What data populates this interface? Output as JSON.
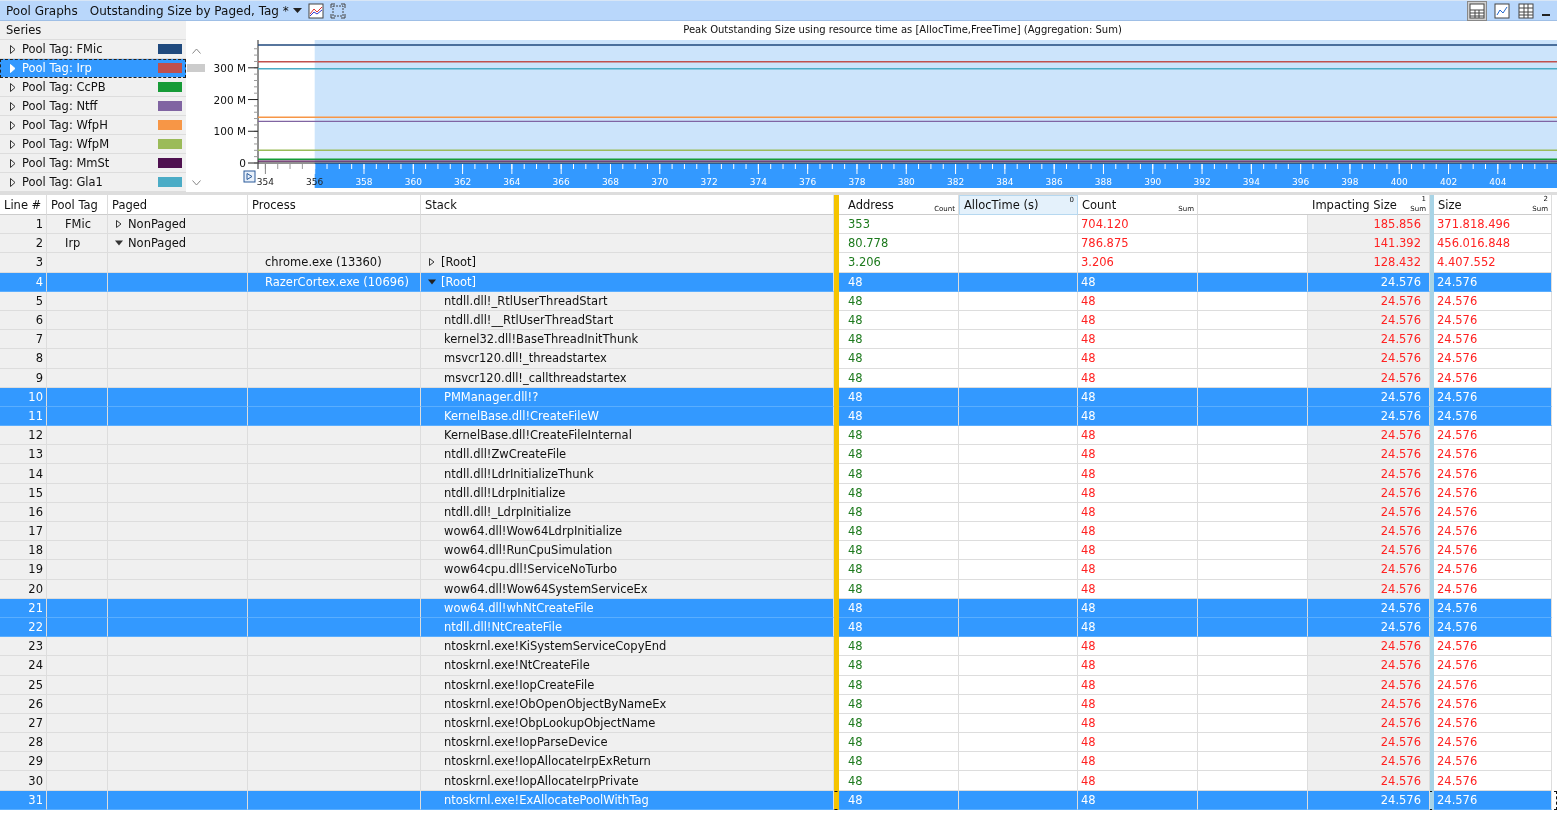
{
  "toolbar": {
    "title": "Pool Graphs",
    "view_name": "Outstanding Size by Paged, Tag *"
  },
  "series_panel": {
    "header": "Series",
    "items": [
      {
        "selected": false
      },
      {
        "selected": true
      },
      {
        "selected": false
      },
      {
        "selected": false
      },
      {
        "selected": false
      },
      {
        "selected": false
      },
      {
        "selected": false
      },
      {
        "selected": false
      }
    ]
  },
  "chart": {
    "chart_data": {
      "type": "line",
      "title": "Peak Outstanding Size using resource time as [AllocTime,FreeTime] (Aggregation: Sum)",
      "x": [
        353.7,
        406.4
      ],
      "xlim": [
        353.7,
        406.4
      ],
      "ylim": [
        0,
        375
      ],
      "xticks": [
        354,
        356,
        358,
        360,
        362,
        364,
        366,
        368,
        370,
        372,
        374,
        376,
        378,
        380,
        382,
        384,
        386,
        388,
        390,
        392,
        394,
        396,
        398,
        400,
        402,
        404
      ],
      "yticks": [
        {
          "value": 0,
          "label": "0"
        },
        {
          "value": 100,
          "label": "100 M"
        },
        {
          "value": 200,
          "label": "200 M"
        },
        {
          "value": 300,
          "label": "300 M"
        }
      ],
      "series": [
        {
          "name": "Pool Tag: FMic",
          "color": "#1f497d",
          "values": [
            372,
            372
          ]
        },
        {
          "name": "Pool Tag: Irp",
          "color": "#c0504d",
          "values": [
            319,
            319
          ]
        },
        {
          "name": "Pool Tag: CcPB",
          "color": "#169b37",
          "values": [
            12,
            12
          ]
        },
        {
          "name": "Pool Tag: Ntff",
          "color": "#8064a2",
          "values": [
            131,
            131
          ]
        },
        {
          "name": "Pool Tag: WfpH",
          "color": "#f79646",
          "values": [
            144,
            144
          ]
        },
        {
          "name": "Pool Tag: WfpM",
          "color": "#9bbb59",
          "values": [
            40,
            40
          ]
        },
        {
          "name": "Pool Tag: MmSt",
          "color": "#4f1150",
          "values": [
            6,
            6
          ]
        },
        {
          "name": "Pool Tag: Gla1",
          "color": "#4bacc6",
          "values": [
            297,
            297
          ]
        }
      ]
    }
  },
  "table": {
    "columns": [
      {
        "label": "Line #"
      },
      {
        "label": "Pool Tag"
      },
      {
        "label": "Paged"
      },
      {
        "label": "Process"
      },
      {
        "label": "Stack"
      },
      {
        "label": "Address",
        "agg": "Count"
      },
      {
        "label": "AllocTime (s)",
        "agg": "0"
      },
      {
        "label": "Count",
        "agg": "Sum"
      },
      {
        "label": "Impacting Size",
        "agg": "Sum",
        "index": "1"
      },
      {
        "label": "Size",
        "agg": "Sum",
        "index": "2"
      }
    ],
    "rows": [
      {
        "line": "1",
        "kind": "tag",
        "pool_tag": "FMic",
        "paged": "NonPaged",
        "expanded": false,
        "address": "353",
        "count": "704.120",
        "impacting_size": "185.856",
        "size": "371.818.496",
        "selected": false
      },
      {
        "line": "2",
        "kind": "tag",
        "pool_tag": "Irp",
        "paged": "NonPaged",
        "expanded": true,
        "address": "80.778",
        "count": "786.875",
        "impacting_size": "141.392",
        "size": "456.016.848",
        "selected": false
      },
      {
        "line": "3",
        "kind": "process",
        "process": "chrome.exe (13360)",
        "stack": "[Root]",
        "expanded": false,
        "address": "3.206",
        "count": "3.206",
        "impacting_size": "128.432",
        "size": "4.407.552",
        "selected": false
      },
      {
        "line": "4",
        "kind": "process",
        "process": "RazerCortex.exe (10696)",
        "stack": "[Root]",
        "expanded": true,
        "address": "48",
        "count": "48",
        "impacting_size": "24.576",
        "size": "24.576",
        "selected": true
      },
      {
        "line": "5",
        "kind": "frame",
        "stack": "ntdll.dll!_RtlUserThreadStart",
        "address": "48",
        "count": "48",
        "impacting_size": "24.576",
        "size": "24.576",
        "selected": false
      },
      {
        "line": "6",
        "kind": "frame",
        "stack": "ntdll.dll!__RtlUserThreadStart",
        "address": "48",
        "count": "48",
        "impacting_size": "24.576",
        "size": "24.576",
        "selected": false
      },
      {
        "line": "7",
        "kind": "frame",
        "stack": "kernel32.dll!BaseThreadInitThunk",
        "address": "48",
        "count": "48",
        "impacting_size": "24.576",
        "size": "24.576",
        "selected": false
      },
      {
        "line": "8",
        "kind": "frame",
        "stack": "msvcr120.dll!_threadstartex",
        "address": "48",
        "count": "48",
        "impacting_size": "24.576",
        "size": "24.576",
        "selected": false
      },
      {
        "line": "9",
        "kind": "frame",
        "stack": "msvcr120.dll!_callthreadstartex",
        "address": "48",
        "count": "48",
        "impacting_size": "24.576",
        "size": "24.576",
        "selected": false
      },
      {
        "line": "10",
        "kind": "frame",
        "stack": "PMManager.dll!?",
        "address": "48",
        "count": "48",
        "impacting_size": "24.576",
        "size": "24.576",
        "selected": true
      },
      {
        "line": "11",
        "kind": "frame",
        "stack": "KernelBase.dll!CreateFileW",
        "address": "48",
        "count": "48",
        "impacting_size": "24.576",
        "size": "24.576",
        "selected": true
      },
      {
        "line": "12",
        "kind": "frame",
        "stack": "KernelBase.dll!CreateFileInternal",
        "address": "48",
        "count": "48",
        "impacting_size": "24.576",
        "size": "24.576",
        "selected": false
      },
      {
        "line": "13",
        "kind": "frame",
        "stack": "ntdll.dll!ZwCreateFile",
        "address": "48",
        "count": "48",
        "impacting_size": "24.576",
        "size": "24.576",
        "selected": false
      },
      {
        "line": "14",
        "kind": "frame",
        "stack": "ntdll.dll!LdrInitializeThunk",
        "address": "48",
        "count": "48",
        "impacting_size": "24.576",
        "size": "24.576",
        "selected": false
      },
      {
        "line": "15",
        "kind": "frame",
        "stack": "ntdll.dll!LdrpInitialize",
        "address": "48",
        "count": "48",
        "impacting_size": "24.576",
        "size": "24.576",
        "selected": false
      },
      {
        "line": "16",
        "kind": "frame",
        "stack": "ntdll.dll!_LdrpInitialize",
        "address": "48",
        "count": "48",
        "impacting_size": "24.576",
        "size": "24.576",
        "selected": false
      },
      {
        "line": "17",
        "kind": "frame",
        "stack": "wow64.dll!Wow64LdrpInitialize",
        "address": "48",
        "count": "48",
        "impacting_size": "24.576",
        "size": "24.576",
        "selected": false
      },
      {
        "line": "18",
        "kind": "frame",
        "stack": "wow64.dll!RunCpuSimulation",
        "address": "48",
        "count": "48",
        "impacting_size": "24.576",
        "size": "24.576",
        "selected": false
      },
      {
        "line": "19",
        "kind": "frame",
        "stack": "wow64cpu.dll!ServiceNoTurbo",
        "address": "48",
        "count": "48",
        "impacting_size": "24.576",
        "size": "24.576",
        "selected": false
      },
      {
        "line": "20",
        "kind": "frame",
        "stack": "wow64.dll!Wow64SystemServiceEx",
        "address": "48",
        "count": "48",
        "impacting_size": "24.576",
        "size": "24.576",
        "selected": false
      },
      {
        "line": "21",
        "kind": "frame",
        "stack": "wow64.dll!whNtCreateFile",
        "address": "48",
        "count": "48",
        "impacting_size": "24.576",
        "size": "24.576",
        "selected": true
      },
      {
        "line": "22",
        "kind": "frame",
        "stack": "ntdll.dll!NtCreateFile",
        "address": "48",
        "count": "48",
        "impacting_size": "24.576",
        "size": "24.576",
        "selected": true
      },
      {
        "line": "23",
        "kind": "frame",
        "stack": "ntoskrnl.exe!KiSystemServiceCopyEnd",
        "address": "48",
        "count": "48",
        "impacting_size": "24.576",
        "size": "24.576",
        "selected": false
      },
      {
        "line": "24",
        "kind": "frame",
        "stack": "ntoskrnl.exe!NtCreateFile",
        "address": "48",
        "count": "48",
        "impacting_size": "24.576",
        "size": "24.576",
        "selected": false
      },
      {
        "line": "25",
        "kind": "frame",
        "stack": "ntoskrnl.exe!IopCreateFile",
        "address": "48",
        "count": "48",
        "impacting_size": "24.576",
        "size": "24.576",
        "selected": false
      },
      {
        "line": "26",
        "kind": "frame",
        "stack": "ntoskrnl.exe!ObOpenObjectByNameEx",
        "address": "48",
        "count": "48",
        "impacting_size": "24.576",
        "size": "24.576",
        "selected": false
      },
      {
        "line": "27",
        "kind": "frame",
        "stack": "ntoskrnl.exe!ObpLookupObjectName",
        "address": "48",
        "count": "48",
        "impacting_size": "24.576",
        "size": "24.576",
        "selected": false
      },
      {
        "line": "28",
        "kind": "frame",
        "stack": "ntoskrnl.exe!IopParseDevice",
        "address": "48",
        "count": "48",
        "impacting_size": "24.576",
        "size": "24.576",
        "selected": false
      },
      {
        "line": "29",
        "kind": "frame",
        "stack": "ntoskrnl.exe!IopAllocateIrpExReturn",
        "address": "48",
        "count": "48",
        "impacting_size": "24.576",
        "size": "24.576",
        "selected": false
      },
      {
        "line": "30",
        "kind": "frame",
        "stack": "ntoskrnl.exe!IopAllocateIrpPrivate",
        "address": "48",
        "count": "48",
        "impacting_size": "24.576",
        "size": "24.576",
        "selected": false
      },
      {
        "line": "31",
        "kind": "frame",
        "stack": "ntoskrnl.exe!ExAllocatePoolWithTag",
        "address": "48",
        "count": "48",
        "impacting_size": "24.576",
        "size": "24.576",
        "selected": true
      }
    ]
  }
}
